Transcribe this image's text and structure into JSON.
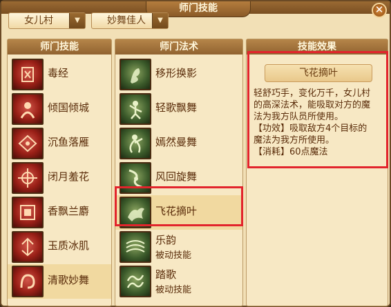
{
  "window": {
    "title": "师门技能",
    "close_glyph": "✕"
  },
  "filters": {
    "sect": "女儿村",
    "role": "妙舞佳人",
    "arrow_glyph": "▼"
  },
  "skills_panel": {
    "header": "师门技能",
    "items": [
      {
        "label": "毒经",
        "icon": "poison-icon"
      },
      {
        "label": "倾国倾城",
        "icon": "beauty-icon"
      },
      {
        "label": "沉鱼落雁",
        "icon": "fish-icon"
      },
      {
        "label": "闭月羞花",
        "icon": "moon-icon"
      },
      {
        "label": "香飘兰麝",
        "icon": "fragrance-icon"
      },
      {
        "label": "玉质冰肌",
        "icon": "jade-icon"
      },
      {
        "label": "清歌妙舞",
        "icon": "dance-icon"
      }
    ],
    "selected_index": 6
  },
  "spells_panel": {
    "header": "师门法术",
    "items": [
      {
        "label": "移形换影",
        "sub": "",
        "icon": "shadow-shift-icon"
      },
      {
        "label": "轻歌飘舞",
        "sub": "",
        "icon": "light-dance-icon"
      },
      {
        "label": "嫣然曼舞",
        "sub": "",
        "icon": "graceful-dance-icon"
      },
      {
        "label": "风回旋舞",
        "sub": "",
        "icon": "whirl-dance-icon"
      },
      {
        "label": "飞花摘叶",
        "sub": "",
        "icon": "flying-flower-icon"
      },
      {
        "label": "乐韵",
        "sub": "被动技能",
        "icon": "melody-icon"
      },
      {
        "label": "踏歌",
        "sub": "被动技能",
        "icon": "step-song-icon"
      }
    ],
    "selected_index": 4
  },
  "effect_panel": {
    "header": "技能效果",
    "skill_name": "飞花摘叶",
    "description": [
      "轻舒巧手，变化万千，女儿村",
      "的高深法术，能吸取对方的魔",
      "法为我方队员所使用。",
      "【功效】吸取敌方4个目标的",
      "魔法为我方所使用。",
      "【消耗】60点魔法"
    ]
  },
  "colors": {
    "highlight": "#e2242c",
    "panel_bg": "#f7e8c4",
    "header_bg": "#a57540",
    "text": "#5a2c0a"
  }
}
